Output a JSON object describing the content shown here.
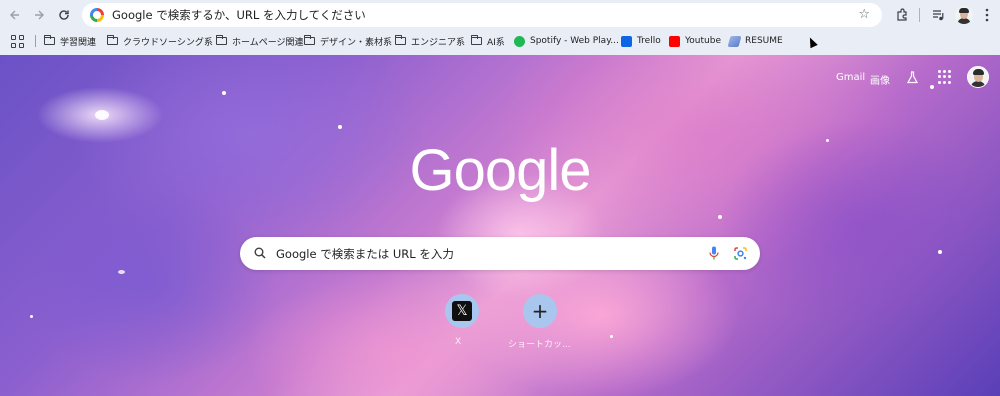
{
  "toolbar": {
    "omnibox_text": "Google で検索するか、URL を入力してください",
    "back_icon": "arrow-left-icon",
    "forward_icon": "arrow-right-icon",
    "reload_icon": "reload-icon"
  },
  "bookmarks": [
    {
      "label": "学習関連",
      "type": "folder"
    },
    {
      "label": "クラウドソーシング系",
      "type": "folder"
    },
    {
      "label": "ホームページ関連",
      "type": "folder"
    },
    {
      "label": "デザイン・素材系",
      "type": "folder"
    },
    {
      "label": "エンジニア系",
      "type": "folder"
    },
    {
      "label": "AI系",
      "type": "folder"
    },
    {
      "label": "Spotify - Web Play...",
      "type": "site"
    },
    {
      "label": "Trello",
      "type": "site"
    },
    {
      "label": "Youtube",
      "type": "site"
    },
    {
      "label": "RESUME",
      "type": "site"
    }
  ],
  "header": {
    "gmail": "Gmail",
    "images": "画像"
  },
  "logo": "Google",
  "search": {
    "placeholder": "Google で検索または URL を入力"
  },
  "shortcuts": [
    {
      "label": "X"
    },
    {
      "label": "ショートカッ..."
    }
  ]
}
